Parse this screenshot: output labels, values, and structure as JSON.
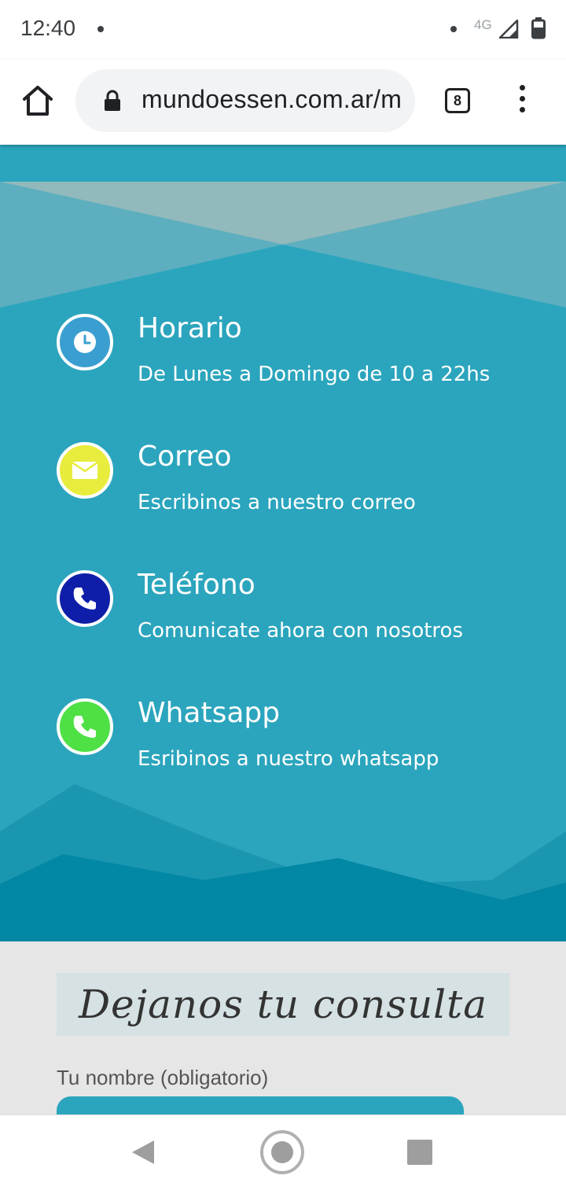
{
  "status_bar": {
    "time": "12:40",
    "network": "4G"
  },
  "browser": {
    "url": "mundoessen.com.ar/m",
    "tab_count": "8"
  },
  "contact": {
    "items": [
      {
        "title": "Horario",
        "description": "De Lunes a Domingo de 10 a 22hs",
        "icon": "clock-icon",
        "color": "#3a9fd0"
      },
      {
        "title": "Correo",
        "description": "Escribinos a nuestro correo",
        "icon": "mail-icon",
        "color": "#e8ec3d"
      },
      {
        "title": "Teléfono",
        "description": "Comunicate ahora con nosotros",
        "icon": "phone-icon",
        "color": "#0f1ea8"
      },
      {
        "title": "Whatsapp",
        "description": "Esribinos a nuestro whatsapp",
        "icon": "whatsapp-phone-icon",
        "color": "#4ee045"
      }
    ]
  },
  "form": {
    "title": "Dejanos tu consulta",
    "name_label": "Tu nombre (obligatorio)",
    "name_value": ""
  },
  "colors": {
    "section_bg": "#2ba5bd",
    "form_bg": "#e6e6e6",
    "title_bg": "#d5e1e3"
  }
}
